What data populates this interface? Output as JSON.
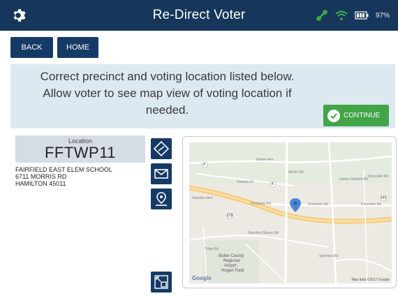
{
  "header": {
    "title": "Re-Direct Voter",
    "battery_pct": "97%",
    "icons": [
      "gear-icon",
      "link-icon",
      "wifi-icon",
      "battery-icon"
    ]
  },
  "nav": {
    "back_label": "BACK",
    "home_label": "HOME"
  },
  "message": {
    "line1": "Correct precinct and voting location listed below.",
    "line2": "Allow voter to see map view of voting location if",
    "line3": "needed.",
    "continue_label": "CONTINUE"
  },
  "location": {
    "label": "Location",
    "code": "FFTWP11",
    "address": [
      "FAIRFIELD EAST ELEM SCHOOL",
      "6711 MORRIS RD",
      "HAMILTON 45011"
    ]
  },
  "map": {
    "labels": {
      "l1": "Hunter Ave",
      "l2": "Hermes Dr",
      "l3": "Hamilton Ave",
      "l4": "Princeton Rd",
      "l5": "Princeton Rd",
      "l6": "Princeton Rd",
      "l7": "Hamilton Mason Rd",
      "l8": "Morris Rd",
      "l9": "Liberty Fairfield Rd",
      "l10": "Tylersville Rd",
      "l11": "Tuley Rd",
      "l12": "Symmes Rd",
      "l13": "Butler County",
      "l14": "Regional",
      "l15": "Airport -",
      "l16": "Hogan Field",
      "road_4": "4",
      "road_4b": "4",
      "road_129": "129",
      "road_747": "747"
    },
    "google": "Google",
    "attribution": "Map data ©2017 Google"
  },
  "colors": {
    "header": "#16365b",
    "button": "#163a66",
    "accent_green": "#43a548",
    "panel": "#dce9f1"
  }
}
